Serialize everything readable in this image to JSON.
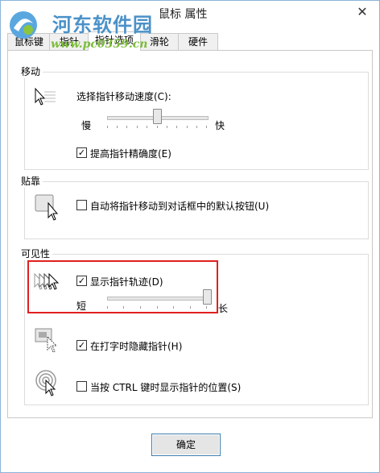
{
  "window": {
    "title": "鼠标 属性"
  },
  "watermark": {
    "site_name": "河东软件园",
    "url": "www.pc0359.cn"
  },
  "tabs": [
    {
      "label": "鼠标键",
      "active": false
    },
    {
      "label": "指针",
      "active": false
    },
    {
      "label": "指针选项",
      "active": true
    },
    {
      "label": "滑轮",
      "active": false
    },
    {
      "label": "硬件",
      "active": false
    }
  ],
  "motion": {
    "label": "移动",
    "speed_label": "选择指针移动速度(C):",
    "slow_label": "慢",
    "fast_label": "快",
    "speed_level": 0.5,
    "precision_label": "提高指针精确度(E)",
    "precision_checked": true
  },
  "snap": {
    "label": "贴靠",
    "snap_label": "自动将指针移动到对话框中的默认按钮(U)",
    "snap_checked": false
  },
  "visibility": {
    "label": "可见性",
    "trails_label": "显示指针轨迹(D)",
    "trails_checked": true,
    "short_label": "短",
    "long_label": "长",
    "trails_level": 1.0,
    "hide_typing_label": "在打字时隐藏指针(H)",
    "hide_typing_checked": true,
    "show_ctrl_label": "当按 CTRL 键时显示指针的位置(S)",
    "show_ctrl_checked": false
  },
  "footer": {
    "ok_label": "确定"
  },
  "icons": {
    "close": "close-icon",
    "motion": "pointer-speed-icon",
    "snap": "snap-to-button-icon",
    "trails": "pointer-trails-icon",
    "hide": "hide-pointer-icon",
    "ctrl": "ctrl-locate-icon"
  }
}
